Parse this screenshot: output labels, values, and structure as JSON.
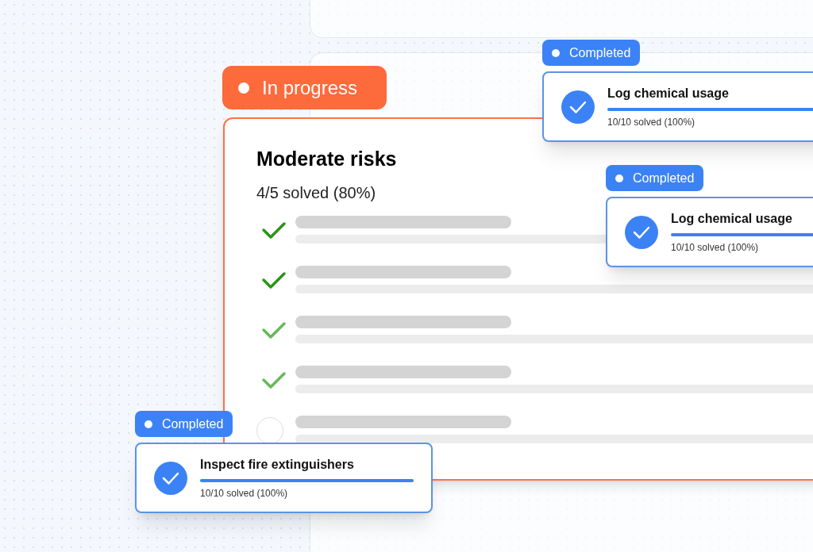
{
  "status_badge": {
    "label": "In progress"
  },
  "risk_card": {
    "title": "Moderate risks",
    "summary": "4/5 solved (80%)",
    "items": [
      {
        "checked": true
      },
      {
        "checked": true
      },
      {
        "checked": true
      },
      {
        "checked": true
      },
      {
        "checked": false
      }
    ]
  },
  "completed_cards": [
    {
      "badge": "Completed",
      "title": "Log chemical usage",
      "level": 1,
      "summary": "10/10 solved (100%)"
    },
    {
      "badge": "Completed",
      "title": "Log chemical usage",
      "level": 1,
      "summary": "10/10 solved (100%)"
    },
    {
      "badge": "Completed",
      "title": "Inspect fire extinguishers",
      "level": 1,
      "summary": "10/10 solved (100%)"
    }
  ]
}
